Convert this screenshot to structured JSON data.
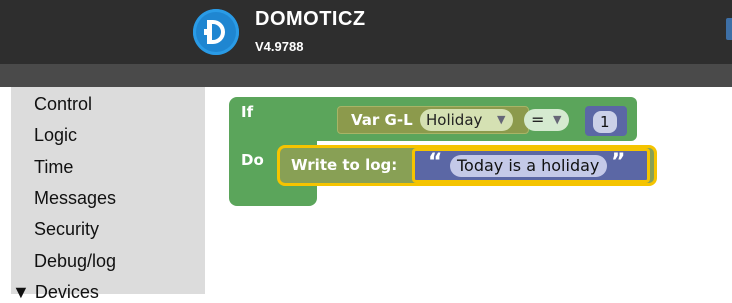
{
  "header": {
    "app_title": "DOMOTICZ",
    "version": "V4.9788"
  },
  "toolbox": {
    "items": [
      "Control",
      "Logic",
      "Time",
      "Messages",
      "Security",
      "Debug/log",
      "▼ Devices"
    ]
  },
  "blocks": {
    "if_label": "If",
    "do_label": "Do",
    "var_label": "Var G-L",
    "variable_value": "Holiday",
    "operator_value": "=",
    "number_value": "1",
    "log_label": "Write to log:",
    "quote_open": "“",
    "quote_close": "”",
    "text_value": "Today is a holiday"
  },
  "icons": {
    "dropdown_arrow": "▼"
  },
  "colors": {
    "header_bg": "#2e2e2e",
    "logo_blue": "#1f86d1",
    "logic_green": "#5ba55b",
    "variable_olive": "#8c9a4c",
    "math_blue": "#5b67a5",
    "selection_yellow": "#f5c400"
  }
}
